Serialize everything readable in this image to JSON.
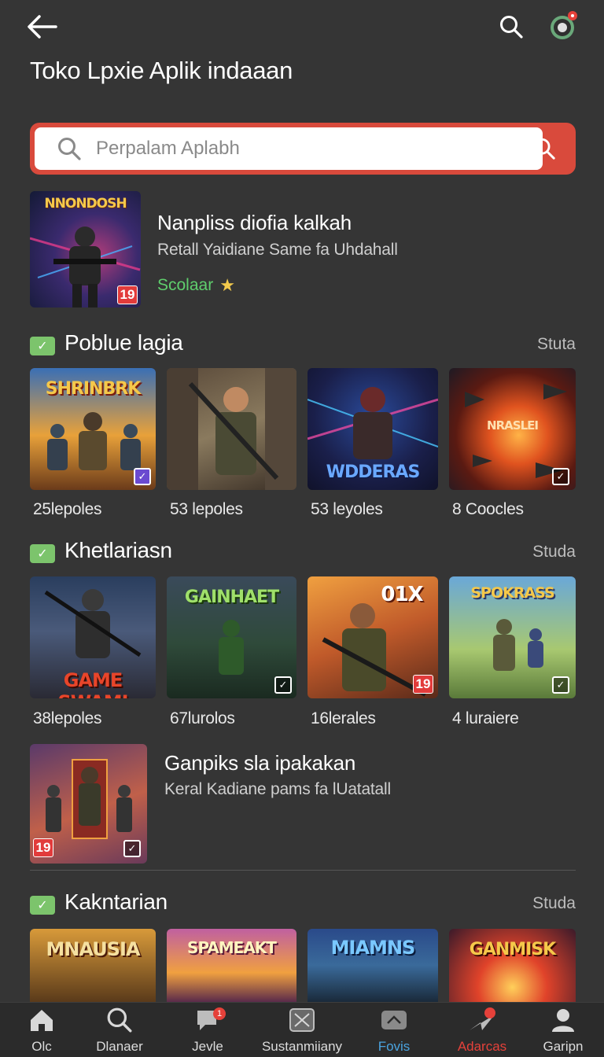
{
  "header": {
    "title": "Toko Lpxie Aplik indaaan",
    "search_icon": "search-icon",
    "avatar_icon": "avatar-icon"
  },
  "search": {
    "placeholder": "Perpalam Aplabh"
  },
  "featured": {
    "art_title": "NNONDOSH",
    "age": "19",
    "title": "Nanpliss diofia kalkah",
    "subtitle": "Retall Yaidiane Same fa Uhdahall",
    "rating": "Scolaar"
  },
  "sections": [
    {
      "title": "Poblue lagia",
      "more": "Stuta",
      "items": [
        {
          "art": "SHRINBRK",
          "caption": "25lepoles"
        },
        {
          "art": "",
          "caption": "53 lepoles"
        },
        {
          "art": "WDDERAS",
          "caption": "53 leyoles"
        },
        {
          "art": "NRASLEI",
          "caption": "8 Coocles"
        }
      ]
    },
    {
      "title": "Khetlariasn",
      "more": "Studa",
      "items": [
        {
          "art": "GAME SWAMI",
          "caption": "38lepoles"
        },
        {
          "art": "GAINHAET",
          "caption": "67lurolos"
        },
        {
          "art": "01X",
          "caption": "16lerales",
          "age": "19"
        },
        {
          "art": "SPOKRASS",
          "caption": "4 luraiere"
        }
      ]
    },
    {
      "title": "Kakntarian",
      "more": "Studa",
      "items": [
        {
          "art": "MNAUSIA"
        },
        {
          "art": "SPAMEAKT"
        },
        {
          "art": "MIAMNS"
        },
        {
          "art": "GANMISK"
        }
      ]
    }
  ],
  "featured2": {
    "age": "19",
    "title": "Ganpiks sla ipakakan",
    "subtitle": "Keral Kadiane pams fa lUatatall"
  },
  "nav": [
    {
      "label": "Olc",
      "icon": "home-icon"
    },
    {
      "label": "Dlanaer",
      "icon": "search-icon"
    },
    {
      "label": "Jevle",
      "icon": "chat-icon",
      "badge": "1"
    },
    {
      "label": "Sustanmiiany",
      "icon": "box-icon"
    },
    {
      "label": "Fovis",
      "icon": "folder-icon",
      "color": "#4aa3df"
    },
    {
      "label": "Adarcas",
      "icon": "plane-icon",
      "color": "#e5413a"
    },
    {
      "label": "Garipn",
      "icon": "profile-icon"
    }
  ]
}
